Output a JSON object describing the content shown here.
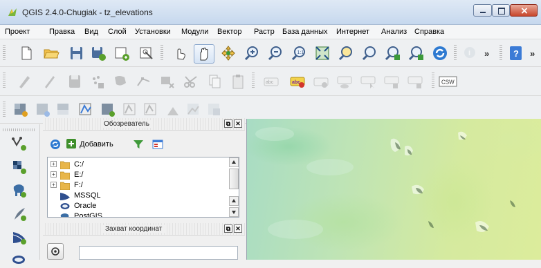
{
  "window": {
    "title": "QGIS 2.4.0-Chugiak - tz_elevations",
    "controls": {
      "minimize": "minimize-icon",
      "maximize": "maximize-icon",
      "close": "close-icon"
    }
  },
  "menubar": {
    "items": [
      "Проект",
      "Правка",
      "Вид",
      "Слой",
      "Установки",
      "Модули",
      "Вектор",
      "Растр",
      "База данных",
      "Интернет",
      "Анализ",
      "Справка"
    ]
  },
  "toolbars": {
    "overflow_label": "»",
    "label_tool_csw": "CSW",
    "label_tool_abc": "abc"
  },
  "browser_panel": {
    "title": "Обозреватель",
    "add_button": "Добавить",
    "tree": [
      {
        "label": "C:/",
        "icon": "folder-icon",
        "expandable": true
      },
      {
        "label": "E:/",
        "icon": "folder-icon",
        "expandable": true
      },
      {
        "label": "F:/",
        "icon": "folder-icon",
        "expandable": true
      },
      {
        "label": "MSSQL",
        "icon": "mssql-icon",
        "expandable": false
      },
      {
        "label": "Oracle",
        "icon": "oracle-icon",
        "expandable": false
      },
      {
        "label": "PostGIS",
        "icon": "postgis-icon",
        "expandable": false
      }
    ]
  },
  "coord_panel": {
    "title": "Захват координат",
    "value": ""
  },
  "colors": {
    "accent": "#3874c8",
    "map_low": "#a8dcc4",
    "map_high": "#dcec9c"
  }
}
